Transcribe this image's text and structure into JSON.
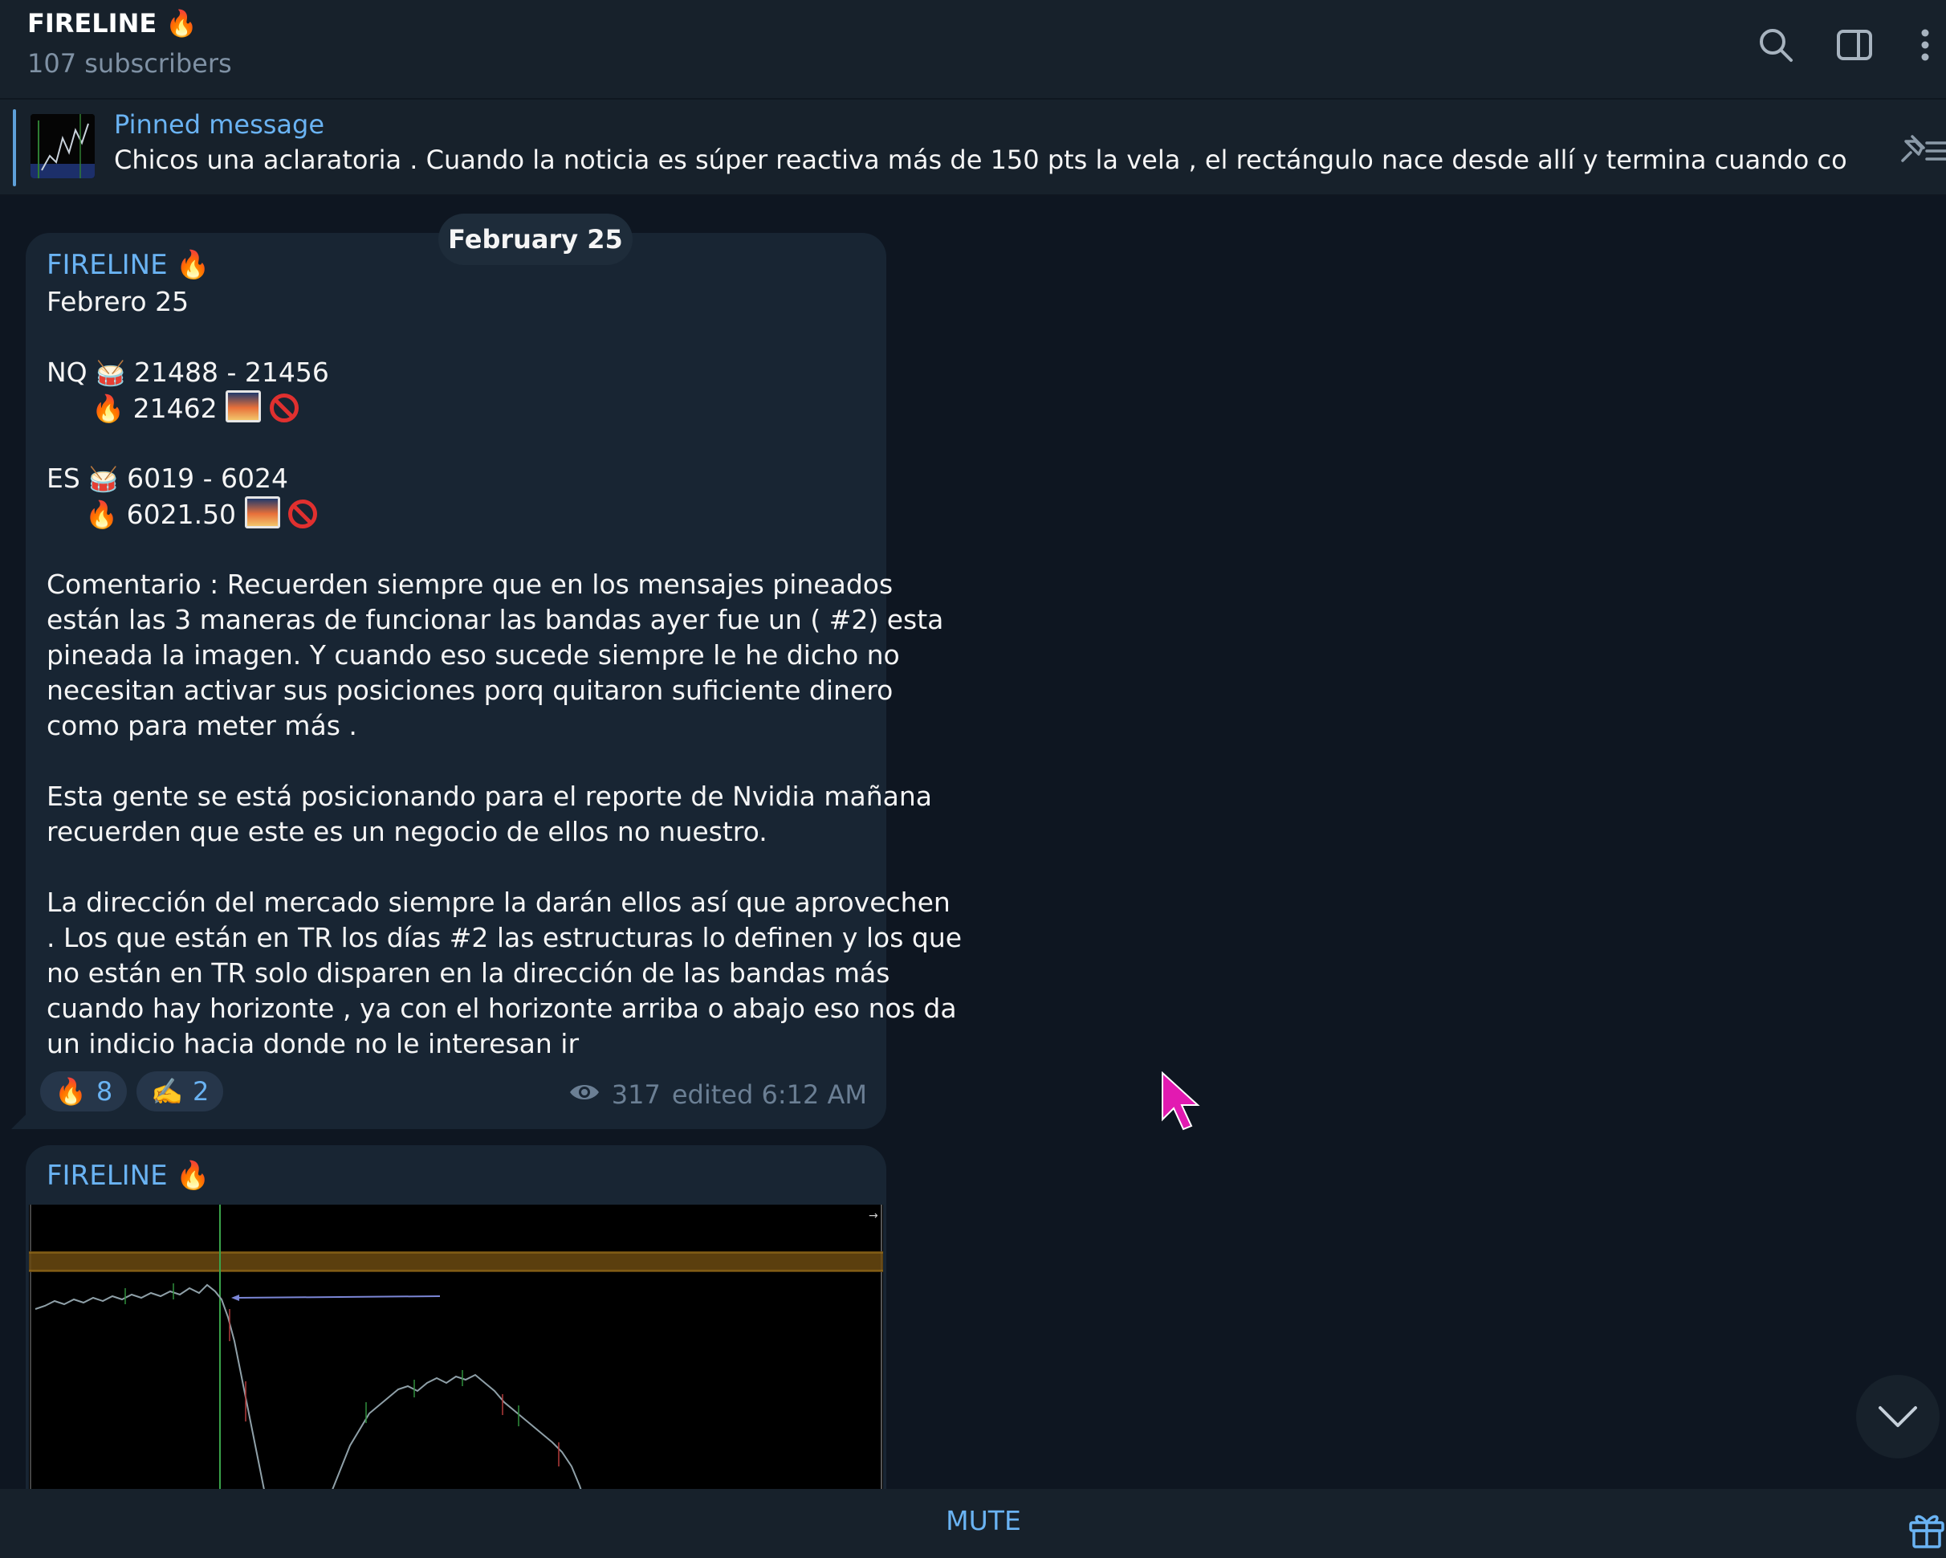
{
  "header": {
    "title": "FIRELINE 🔥",
    "subtitle": "107 subscribers",
    "icons": [
      "search-icon",
      "sidebar-toggle-icon",
      "more-menu-icon"
    ]
  },
  "pinned": {
    "label": "Pinned message",
    "text": "Chicos una aclaratoria .  Cuando la noticia es súper reactiva más de 150 pts la vela , el rectángulo nace desde allí y termina cuando complete las..."
  },
  "date_separator": "February 25",
  "messages": [
    {
      "sender": "FIRELINE 🔥",
      "lines": {
        "l1": "Febrero 25",
        "nq_label": "NQ",
        "nq_range": "21488 - 21456",
        "nq_level": "21462",
        "es_label": "ES",
        "es_range": "6019 - 6024",
        "es_level": "6021.50",
        "p1": [
          "Comentario : Recuerden siempre que en los mensajes pineados",
          "están las 3 maneras de funcionar las bandas ayer fue un ( #2) esta",
          "pineada la imagen. Y cuando eso sucede siempre le he dicho no",
          "necesitan activar sus posiciones porq quitaron suficiente dinero",
          "como para meter más ."
        ],
        "p2": [
          "Esta gente se está posicionando para el reporte de Nvidia mañana",
          "recuerden que este es un negocio de ellos no nuestro."
        ],
        "p3": [
          "La dirección del mercado siempre la darán ellos así que aprovechen",
          ". Los que están en TR los días #2 las estructuras lo definen y los que",
          "no están en TR solo disparen en la dirección de las bandas más",
          "cuando hay horizonte , ya con el horizonte arriba o abajo eso nos da",
          "un indicio hacia donde no le interesan ir"
        ]
      },
      "emoji": {
        "drum": "🥁",
        "fire": "🔥"
      },
      "reactions": [
        {
          "emoji": "🔥",
          "count": "8"
        },
        {
          "emoji": "✍️",
          "count": "2"
        }
      ],
      "views": "317",
      "edited": "edited 6:12 AM"
    },
    {
      "sender": "FIRELINE 🔥",
      "sticker_emoji": "👲"
    }
  ],
  "bottom": {
    "mute_label": "MUTE"
  },
  "colors": {
    "accent": "#6ab3f3",
    "bg": "#0e1621",
    "panel": "#17212b",
    "bubble": "#182533"
  }
}
